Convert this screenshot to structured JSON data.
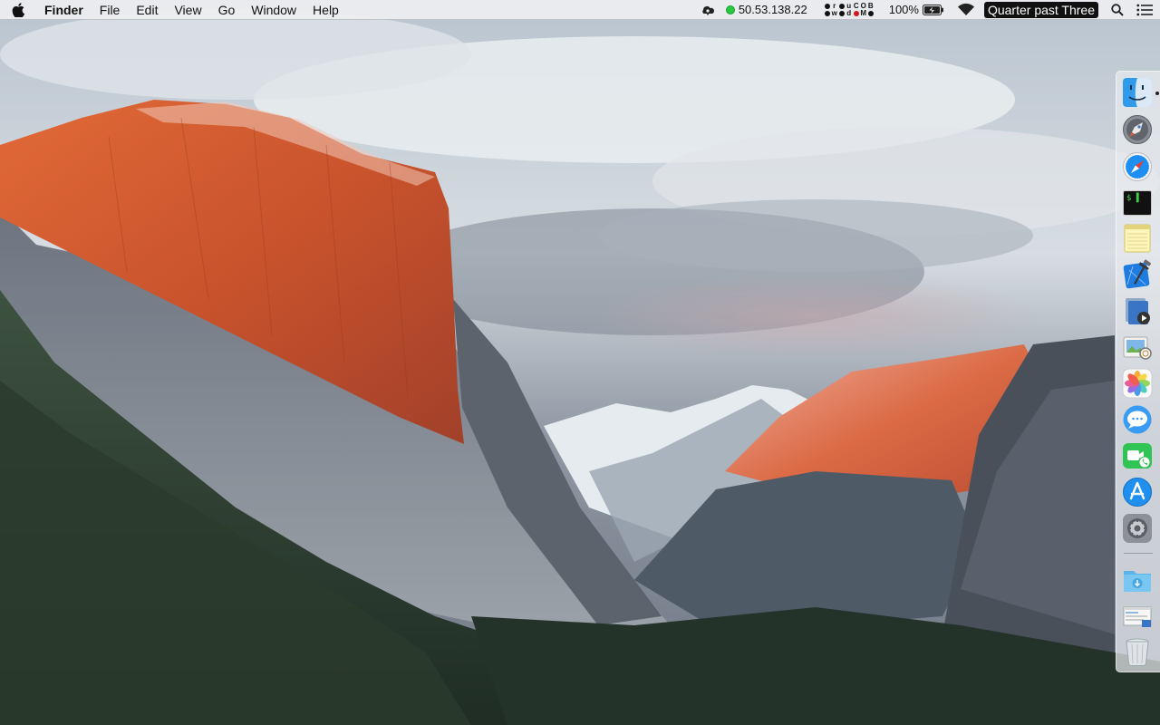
{
  "menubar": {
    "app_name": "Finder",
    "menus": [
      "File",
      "Edit",
      "View",
      "Go",
      "Window",
      "Help"
    ],
    "status": {
      "ip_address": "50.53.138.22",
      "widget_top": [
        "•",
        "r",
        "•",
        "u",
        "C",
        "O",
        "B"
      ],
      "widget_bottom": [
        "•",
        "w",
        "•",
        "d",
        "•",
        "M",
        "•"
      ],
      "battery_percent": "100%",
      "clock": "Quarter past Three"
    }
  },
  "dock": {
    "items": [
      {
        "name": "Finder",
        "icon": "finder-icon"
      },
      {
        "name": "Launchpad",
        "icon": "launchpad-icon"
      },
      {
        "name": "Safari",
        "icon": "safari-icon"
      },
      {
        "name": "Terminal",
        "icon": "terminal-icon"
      },
      {
        "name": "Notes",
        "icon": "notes-icon"
      },
      {
        "name": "Xcode",
        "icon": "xcode-icon"
      },
      {
        "name": "QuickTime Player",
        "icon": "quicktime-icon"
      },
      {
        "name": "Preview",
        "icon": "preview-icon"
      },
      {
        "name": "Photos",
        "icon": "photos-icon"
      },
      {
        "name": "Messages",
        "icon": "messages-icon"
      },
      {
        "name": "FaceTime",
        "icon": "facetime-icon"
      },
      {
        "name": "App Store",
        "icon": "app-store-icon"
      },
      {
        "name": "System Preferences",
        "icon": "system-preferences-icon"
      },
      {
        "name": "Downloads",
        "icon": "downloads-folder-icon"
      },
      {
        "name": "Window Thumbnail",
        "icon": "window-thumbnail-icon"
      },
      {
        "name": "Trash",
        "icon": "trash-icon"
      }
    ],
    "terminal_glyph": "$ ▌"
  },
  "colors": {
    "menubar_bg": "#eeeef0",
    "clock_bg": "#111111",
    "status_green": "#28c840",
    "rock_glow": "#d8602c"
  }
}
